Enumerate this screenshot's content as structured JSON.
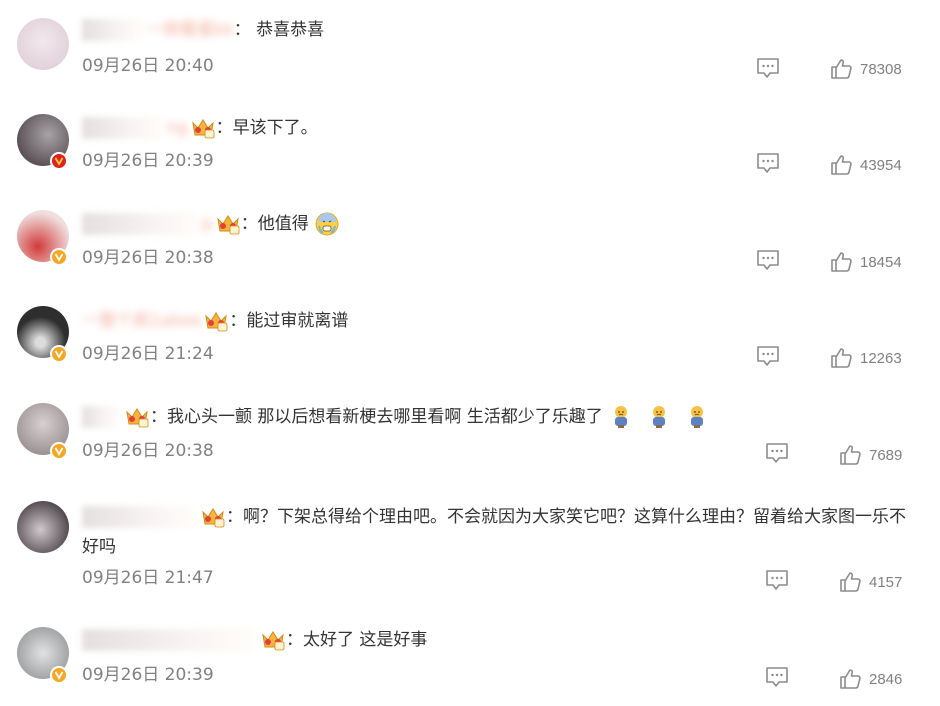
{
  "comments": [
    {
      "username": "一倒霉蛋kk",
      "text": "恭喜恭喜",
      "timestamp": "09月26日 20:40",
      "likes": "78308",
      "badge": "none",
      "has_crown": false,
      "emojis": [],
      "avatar_color": "#e6d8df"
    },
    {
      "username": "ng",
      "text": "早该下了。",
      "timestamp": "09月26日 20:39",
      "likes": "43954",
      "badge": "red",
      "has_crown": true,
      "emojis": [],
      "avatar_color": "#7a7478"
    },
    {
      "username": "p",
      "text": "他值得",
      "timestamp": "09月26日 20:38",
      "likes": "18454",
      "badge": "gold",
      "has_crown": true,
      "emojis": [
        "cold-sweat-emoji"
      ],
      "avatar_color": "#c44848"
    },
    {
      "username": "一整个疯1akee",
      "text": "能过审就离谱",
      "timestamp": "09月26日 21:24",
      "likes": "12263",
      "badge": "gold",
      "has_crown": true,
      "emojis": [],
      "avatar_color": "#3a3a3a"
    },
    {
      "username": "",
      "text": "我心头一颤 那以后想看新梗去哪里看啊 生活都少了乐趣了",
      "timestamp": "09月26日 20:38",
      "likes": "7689",
      "badge": "gold",
      "has_crown": true,
      "emojis": [
        "sad-doll-emoji",
        "sad-doll-emoji",
        "sad-doll-emoji"
      ],
      "avatar_color": "#b8aeb0"
    },
    {
      "username": "",
      "text": "啊？下架总得给个理由吧。不会就因为大家笑它吧？这算什么理由？留着给大家图一乐不好吗",
      "timestamp": "09月26日 21:47",
      "likes": "4157",
      "badge": "none",
      "has_crown": true,
      "emojis": [],
      "avatar_color": "#8a8288"
    },
    {
      "username": "",
      "text": "太好了 这是好事",
      "timestamp": "09月26日 20:39",
      "likes": "2846",
      "badge": "gold",
      "has_crown": true,
      "emojis": [],
      "avatar_color": "#b0b2b4"
    }
  ],
  "colors": {
    "username": "#eb7350",
    "timestamp": "#808080",
    "text": "#333333",
    "badge_gold": "#f5a623",
    "badge_red": "#e0211f"
  }
}
